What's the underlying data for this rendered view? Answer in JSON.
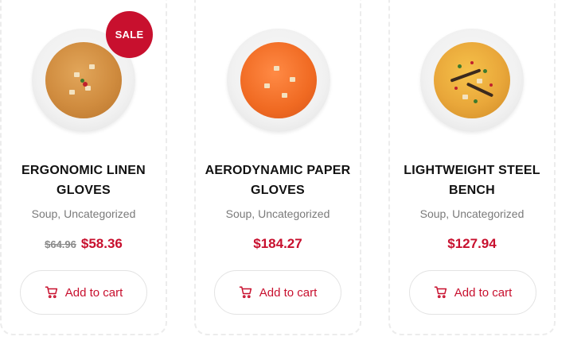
{
  "products": [
    {
      "title": "ERGONOMIC LINEN GLOVES",
      "categories": "Soup, Uncategorized",
      "old_price": "$64.96",
      "price": "$58.36",
      "badge": "SALE",
      "button_label": "Add to cart"
    },
    {
      "title": "AERODYNAMIC PAPER GLOVES",
      "categories": "Soup, Uncategorized",
      "price": "$184.27",
      "button_label": "Add to cart"
    },
    {
      "title": "LIGHTWEIGHT STEEL BENCH",
      "categories": "Soup, Uncategorized",
      "price": "$127.94",
      "button_label": "Add to cart"
    }
  ],
  "colors": {
    "accent": "#c8102e",
    "muted_text": "#7a7a7a",
    "card_border": "#ececec"
  },
  "icons": {
    "cart": "shopping-cart-icon"
  }
}
